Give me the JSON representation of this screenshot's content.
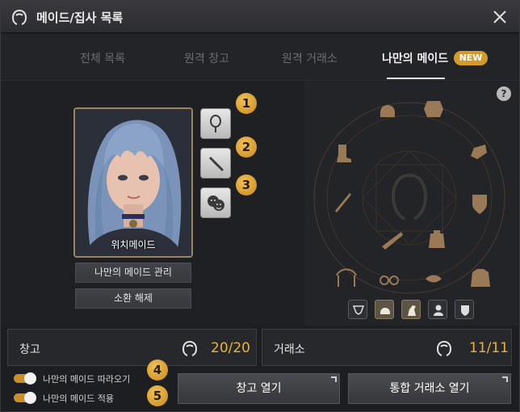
{
  "window": {
    "title": "메이드/집사 목록"
  },
  "tabs": [
    {
      "label": "전체 목록"
    },
    {
      "label": "원격 창고"
    },
    {
      "label": "원격 거래소"
    },
    {
      "label": "나만의 메이드",
      "active": true
    }
  ],
  "new_badge": "NEW",
  "maid": {
    "name": "위치메이드",
    "manage_label": "나만의 메이드 관리",
    "dismiss_label": "소환 해제"
  },
  "side_buttons": [
    {
      "icon": "mirror-icon",
      "badge": "1"
    },
    {
      "icon": "hammer-icon",
      "badge": "2"
    },
    {
      "icon": "emotion-faces-icon",
      "badge": "3"
    }
  ],
  "equipment_slots": [
    "helmet-icon",
    "chest-armor-icon",
    "gloves-icon",
    "shield-icon",
    "armor-icon",
    "dagger-icon",
    "boots-icon",
    "sword-icon",
    "underwear-icon",
    "lips-icon",
    "glasses-icon",
    "headband-icon",
    "outfit-icon"
  ],
  "filters": [
    {
      "icon": "underwear-filter-icon",
      "on": false
    },
    {
      "icon": "helmet-filter-icon",
      "on": true
    },
    {
      "icon": "horse-filter-icon",
      "on": true
    },
    {
      "icon": "person-filter-icon",
      "on": false
    },
    {
      "icon": "shield-filter-icon",
      "on": false
    }
  ],
  "storage": {
    "label": "창고",
    "count": "20/20"
  },
  "market": {
    "label": "거래소",
    "count": "11/11"
  },
  "toggles": [
    {
      "label": "나만의 메이드 따라오기",
      "badge": "4",
      "on": true
    },
    {
      "label": "나만의 메이드 적용",
      "badge": "5",
      "on": true
    }
  ],
  "buttons": {
    "open_storage": "창고 열기",
    "open_market": "통합 거래소 열기"
  },
  "help": "?",
  "colors": {
    "accent": "#d39a2c",
    "count": "#e6b343"
  }
}
